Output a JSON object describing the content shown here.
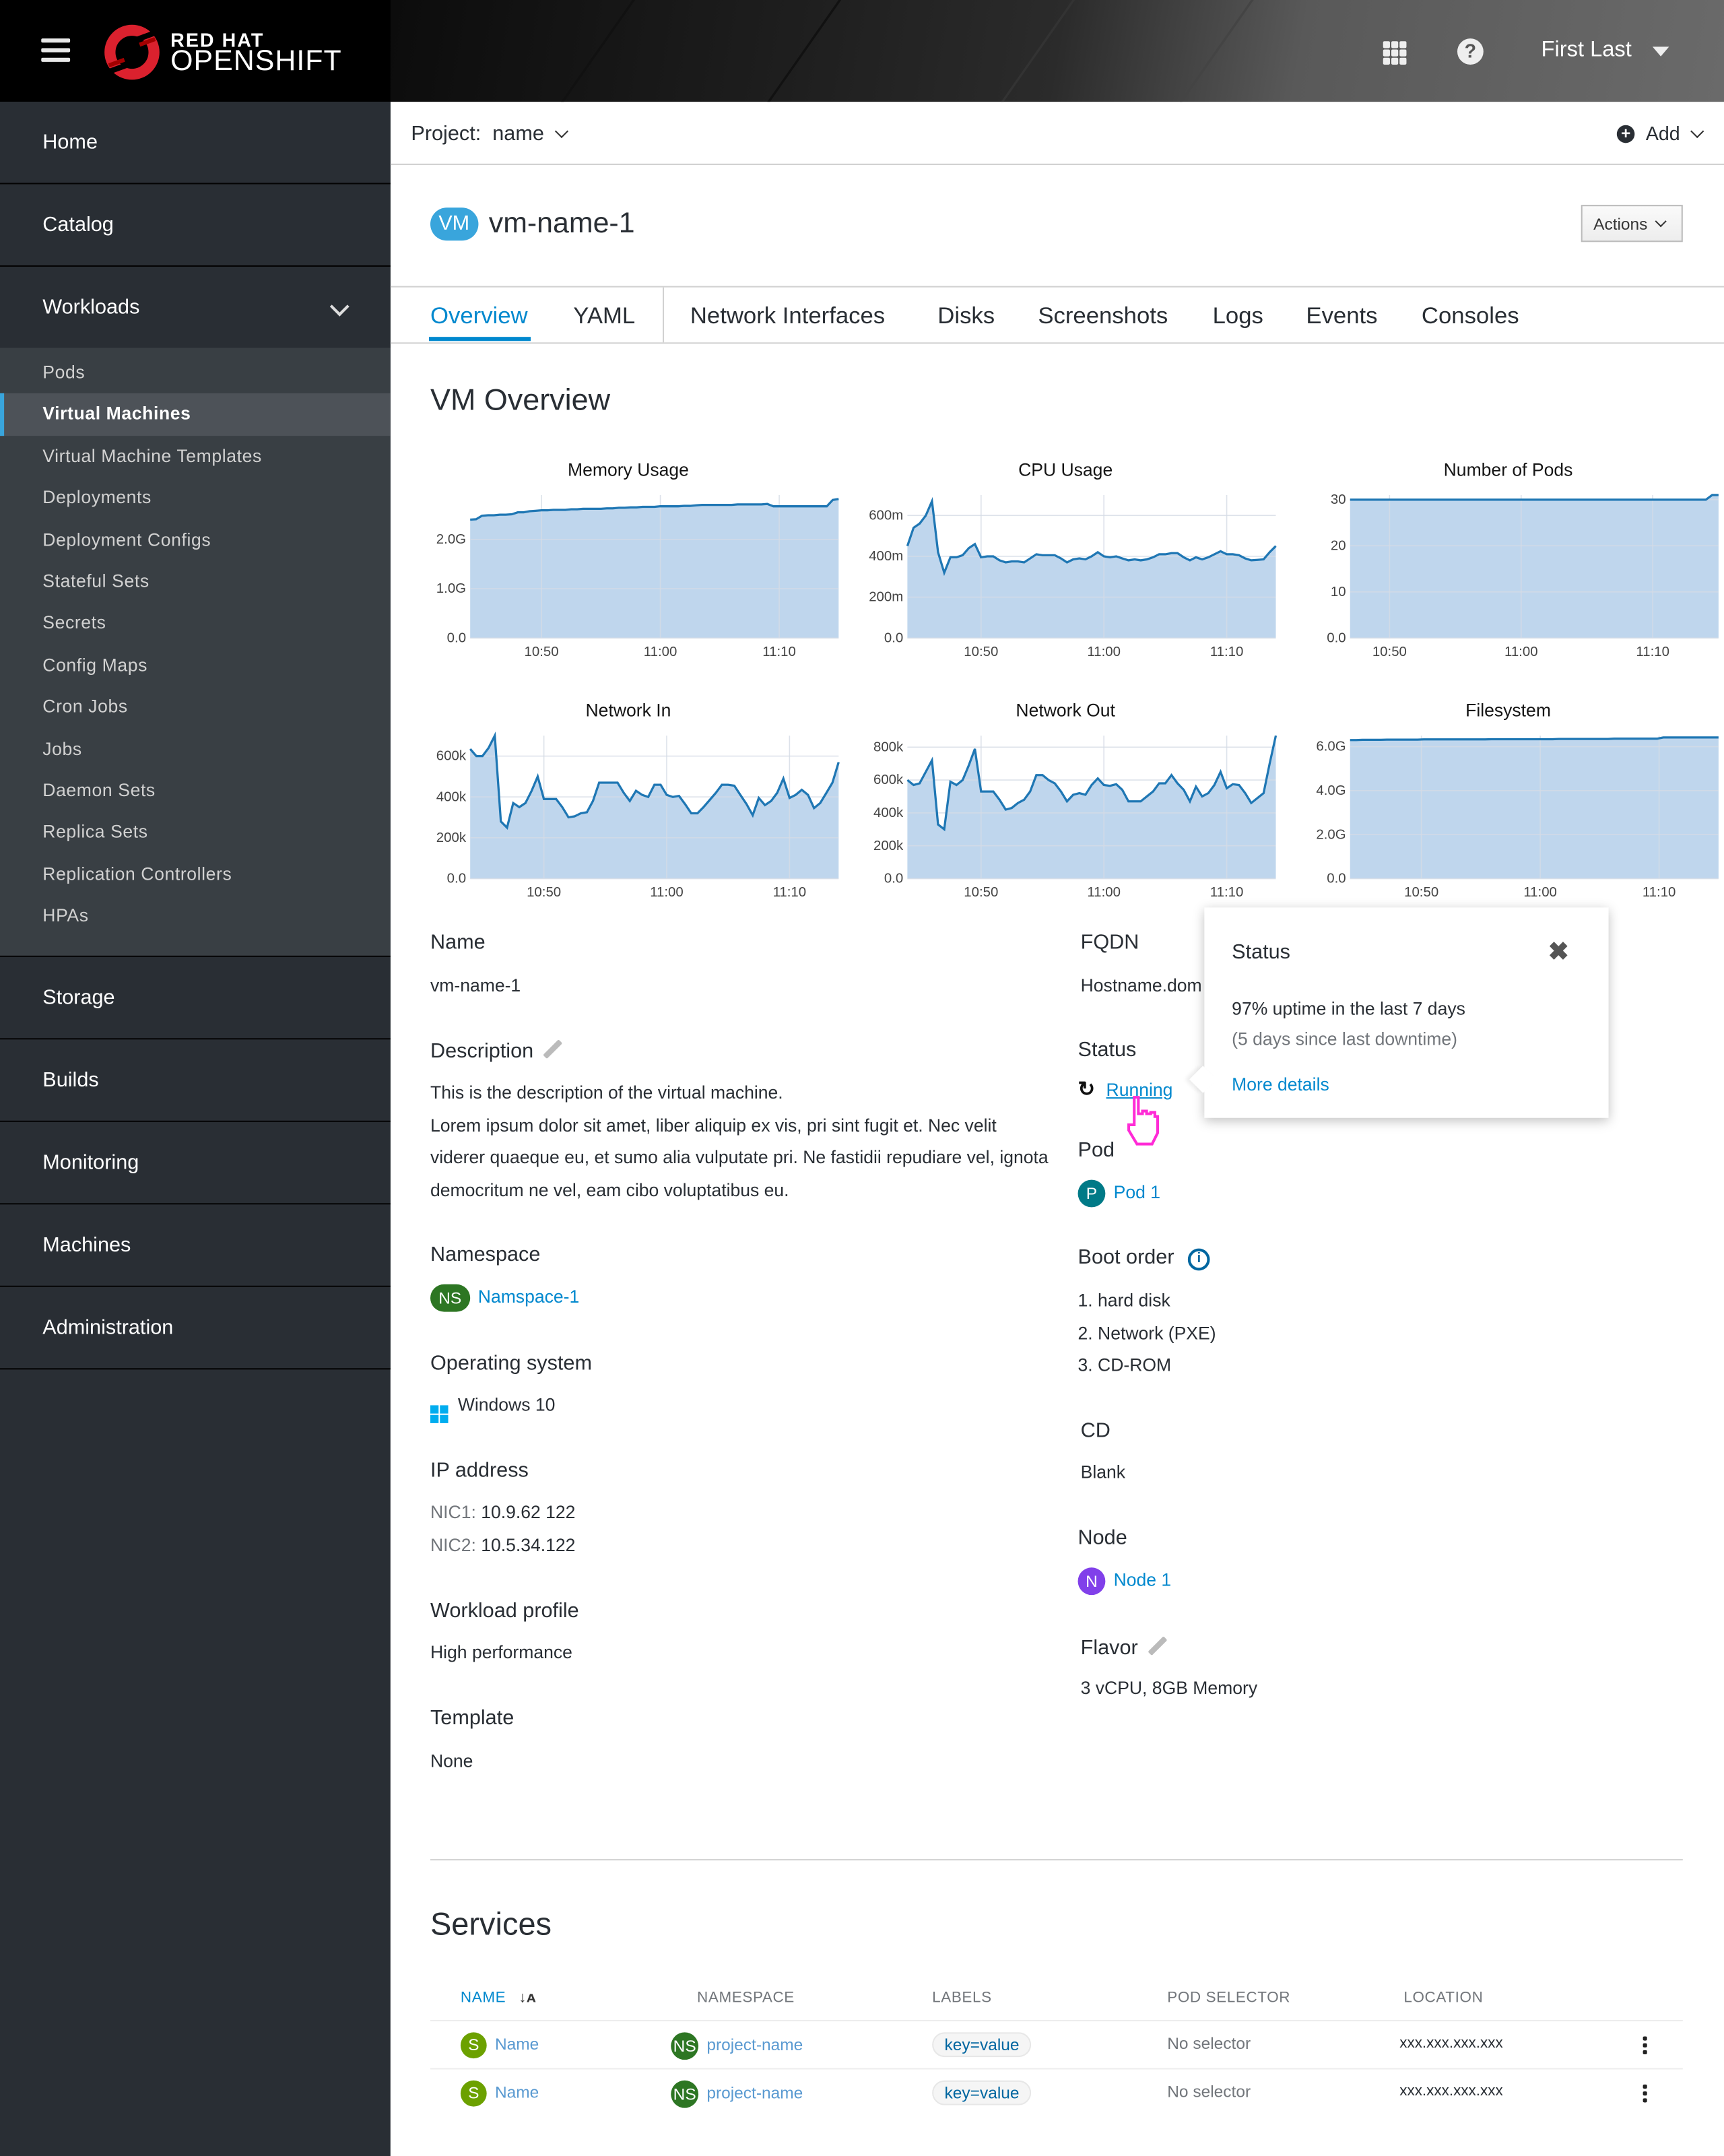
{
  "masthead": {
    "brand_top": "RED HAT",
    "brand_bottom": "OPENSHIFT",
    "user_name": "First Last",
    "icons": [
      "menu-icon",
      "app-launcher-icon",
      "help-icon",
      "caret-down-icon"
    ]
  },
  "sidebar": {
    "items": [
      {
        "label": "Home"
      },
      {
        "label": "Catalog"
      },
      {
        "label": "Workloads",
        "expanded": true
      },
      {
        "label": "Storage"
      },
      {
        "label": "Builds"
      },
      {
        "label": "Monitoring"
      },
      {
        "label": "Machines"
      },
      {
        "label": "Administration"
      }
    ],
    "workloads_sub": [
      {
        "label": "Pods"
      },
      {
        "label": "Virtual Machines",
        "active": true
      },
      {
        "label": "Virtual Machine Templates"
      },
      {
        "label": "Deployments"
      },
      {
        "label": "Deployment Configs"
      },
      {
        "label": "Stateful Sets"
      },
      {
        "label": "Secrets"
      },
      {
        "label": "Config Maps"
      },
      {
        "label": "Cron Jobs"
      },
      {
        "label": "Jobs"
      },
      {
        "label": "Daemon Sets"
      },
      {
        "label": "Replica Sets"
      },
      {
        "label": "Replication Controllers"
      },
      {
        "label": "HPAs"
      }
    ]
  },
  "project_bar": {
    "label": "Project:",
    "value": "name",
    "add_label": "Add"
  },
  "header": {
    "badge": "VM",
    "title": "vm-name-1",
    "actions_label": "Actions"
  },
  "tabs": [
    {
      "label": "Overview",
      "active": true
    },
    {
      "label": "YAML"
    },
    {
      "label": "Network Interfaces"
    },
    {
      "label": "Disks"
    },
    {
      "label": "Screenshots"
    },
    {
      "label": "Logs"
    },
    {
      "label": "Events"
    },
    {
      "label": "Consoles"
    }
  ],
  "overview_title": "VM Overview",
  "colors": {
    "accent": "#0088ce",
    "chart_line": "#1f77b4",
    "chart_fill": "#bfd6ed",
    "ns_badge": "#2d7623",
    "pod_badge": "#007a87",
    "node_badge": "#8140ea",
    "service_badge": "#6ca100"
  },
  "chart_data": [
    {
      "type": "area",
      "title": "Memory Usage",
      "xticks": [
        "10:50",
        "11:00",
        "11:10"
      ],
      "yticks": [
        "0.0",
        "1.0G",
        "2.0G"
      ],
      "ylim": [
        0,
        2.9
      ],
      "x_range": [
        "10:44",
        "11:15"
      ],
      "values": [
        2.4,
        2.41,
        2.48,
        2.49,
        2.49,
        2.5,
        2.5,
        2.51,
        2.55,
        2.55,
        2.57,
        2.58,
        2.59,
        2.59,
        2.6,
        2.6,
        2.6,
        2.61,
        2.61,
        2.62,
        2.62,
        2.62,
        2.62,
        2.63,
        2.63,
        2.64,
        2.64,
        2.65,
        2.65,
        2.66,
        2.66,
        2.66,
        2.67,
        2.67,
        2.67,
        2.67,
        2.68,
        2.68,
        2.69,
        2.7,
        2.7,
        2.7,
        2.7,
        2.7,
        2.7,
        2.71,
        2.71,
        2.71,
        2.71,
        2.71,
        2.72,
        2.67,
        2.67,
        2.67,
        2.67,
        2.67,
        2.67,
        2.67,
        2.67,
        2.67,
        2.67,
        2.8,
        2.82
      ]
    },
    {
      "type": "area",
      "title": "CPU Usage",
      "xticks": [
        "10:50",
        "11:00",
        "11:10"
      ],
      "yticks": [
        "0.0",
        "200m",
        "400m",
        "600m"
      ],
      "ylim": [
        0,
        700
      ],
      "x_range": [
        "10:44",
        "11:14"
      ],
      "values": [
        450,
        540,
        560,
        600,
        670,
        420,
        320,
        395,
        395,
        405,
        440,
        460,
        395,
        400,
        400,
        380,
        370,
        375,
        375,
        370,
        390,
        410,
        405,
        405,
        405,
        390,
        370,
        385,
        390,
        385,
        400,
        420,
        400,
        395,
        400,
        390,
        380,
        385,
        380,
        385,
        395,
        410,
        410,
        415,
        415,
        395,
        380,
        395,
        385,
        395,
        410,
        425,
        410,
        410,
        405,
        390,
        380,
        382,
        385,
        420,
        450
      ]
    },
    {
      "type": "area",
      "title": "Number of Pods",
      "xticks": [
        "10:50",
        "11:00",
        "11:10"
      ],
      "yticks": [
        "0.0",
        "10",
        "20",
        "30"
      ],
      "ylim": [
        0,
        31
      ],
      "x_range": [
        "10:47",
        "11:15"
      ],
      "values": [
        30,
        30,
        30,
        30,
        30,
        30,
        30,
        30,
        30,
        30,
        30,
        30,
        30,
        30,
        30,
        30,
        30,
        30,
        30,
        30,
        30,
        30,
        30,
        30,
        30,
        30,
        30,
        30,
        30,
        30,
        30,
        30,
        30,
        30,
        30,
        30,
        30,
        30,
        30,
        30,
        30,
        30,
        30,
        30,
        30,
        30,
        30,
        30,
        30,
        30,
        30,
        30,
        30,
        30,
        30,
        30,
        30,
        31,
        31
      ]
    },
    {
      "type": "area",
      "title": "Network In",
      "xticks": [
        "10:50",
        "11:00",
        "11:10"
      ],
      "yticks": [
        "0.0",
        "200k",
        "400k",
        "600k"
      ],
      "ylim": [
        0,
        700000
      ],
      "x_range": [
        "10:44",
        "11:14"
      ],
      "values": [
        635000,
        600000,
        600000,
        640000,
        700000,
        280000,
        250000,
        370000,
        350000,
        370000,
        430000,
        500000,
        390000,
        390000,
        390000,
        350000,
        300000,
        305000,
        320000,
        325000,
        380000,
        470000,
        470000,
        470000,
        470000,
        420000,
        380000,
        430000,
        410000,
        400000,
        460000,
        460000,
        410000,
        400000,
        405000,
        365000,
        320000,
        320000,
        350000,
        385000,
        420000,
        460000,
        460000,
        455000,
        410000,
        365000,
        310000,
        395000,
        360000,
        380000,
        420000,
        490000,
        395000,
        410000,
        435000,
        410000,
        345000,
        370000,
        420000,
        470000,
        570000
      ]
    },
    {
      "type": "area",
      "title": "Network Out",
      "xticks": [
        "10:50",
        "11:00",
        "11:10"
      ],
      "yticks": [
        "0.0",
        "200k",
        "400k",
        "600k",
        "800k"
      ],
      "ylim": [
        0,
        870000
      ],
      "x_range": [
        "10:44",
        "11:14"
      ],
      "values": [
        600000,
        570000,
        580000,
        650000,
        720000,
        330000,
        300000,
        590000,
        570000,
        600000,
        690000,
        790000,
        530000,
        530000,
        530000,
        480000,
        420000,
        430000,
        460000,
        480000,
        530000,
        630000,
        630000,
        600000,
        580000,
        530000,
        470000,
        510000,
        520000,
        510000,
        570000,
        610000,
        570000,
        565000,
        575000,
        540000,
        470000,
        470000,
        470000,
        500000,
        530000,
        580000,
        580000,
        630000,
        580000,
        540000,
        470000,
        560000,
        500000,
        520000,
        570000,
        650000,
        550000,
        575000,
        570000,
        520000,
        460000,
        490000,
        520000,
        700000,
        870000
      ]
    },
    {
      "type": "area",
      "title": "Filesystem",
      "xticks": [
        "10:50",
        "11:00",
        "11:10"
      ],
      "yticks": [
        "0.0",
        "2.0G",
        "4.0G",
        "6.0G"
      ],
      "ylim": [
        0,
        6.5
      ],
      "x_range": [
        "10:44",
        "11:15"
      ],
      "values": [
        6.3,
        6.3,
        6.31,
        6.31,
        6.31,
        6.31,
        6.32,
        6.32,
        6.32,
        6.32,
        6.32,
        6.32,
        6.33,
        6.33,
        6.33,
        6.33,
        6.33,
        6.33,
        6.33,
        6.33,
        6.33,
        6.33,
        6.33,
        6.34,
        6.34,
        6.34,
        6.34,
        6.34,
        6.34,
        6.34,
        6.34,
        6.34,
        6.34,
        6.34,
        6.35,
        6.35,
        6.35,
        6.35,
        6.35,
        6.35,
        6.35,
        6.35,
        6.35,
        6.36,
        6.36,
        6.36,
        6.36,
        6.36,
        6.36,
        6.36,
        6.36,
        6.42,
        6.42,
        6.42,
        6.42,
        6.42,
        6.42,
        6.42,
        6.42,
        6.42,
        6.42
      ]
    }
  ],
  "details_left": {
    "name_label": "Name",
    "name_value": "vm-name-1",
    "description_label": "Description",
    "description_lines": [
      "This is the description of the virtual machine.",
      "Lorem ipsum dolor sit amet, liber aliquip ex vis, pri sint fugit et. Nec velit viderer quaeque eu, et sumo alia vulputate pri. Ne fastidii repudiare vel, ignota democritum ne vel, eam cibo voluptatibus eu."
    ],
    "namespace_label": "Namespace",
    "namespace_badge": "NS",
    "namespace_value": "Namspace-1",
    "os_label": "Operating system",
    "os_value": "Windows 10",
    "ip_label": "IP address",
    "nic1_label": "NIC1:",
    "nic1_value": "10.9.62 122",
    "nic2_label": "NIC2:",
    "nic2_value": "10.5.34.122",
    "workload_label": "Workload profile",
    "workload_value": "High performance",
    "template_label": "Template",
    "template_value": "None"
  },
  "details_right": {
    "fqdn_label": "FQDN",
    "fqdn_value": "Hostname.dom",
    "status_label": "Status",
    "status_value": "Running",
    "pod_label": "Pod",
    "pod_badge": "P",
    "pod_value": "Pod 1",
    "boot_label": "Boot order",
    "boot_items": [
      "1. hard disk",
      "2. Network (PXE)",
      "3. CD-ROM"
    ],
    "cd_label": "CD",
    "cd_value": "Blank",
    "node_label": "Node",
    "node_badge": "N",
    "node_value": "Node 1",
    "flavor_label": "Flavor",
    "flavor_value": "3 vCPU, 8GB Memory"
  },
  "popover": {
    "title": "Status",
    "line1": "97% uptime in the last 7 days",
    "line2": "(5 days since last downtime)",
    "link": "More details"
  },
  "services": {
    "title": "Services",
    "columns": [
      "NAME",
      "NAMESPACE",
      "LABELS",
      "POD SELECTOR",
      "LOCATION"
    ],
    "rows": [
      {
        "badge": "S",
        "name": "Name",
        "ns_badge": "NS",
        "namespace": "project-name",
        "label": "key=value",
        "selector": "No selector",
        "location": "xxx.xxx.xxx.xxx"
      },
      {
        "badge": "S",
        "name": "Name",
        "ns_badge": "NS",
        "namespace": "project-name",
        "label": "key=value",
        "selector": "No selector",
        "location": "xxx.xxx.xxx.xxx"
      }
    ]
  }
}
